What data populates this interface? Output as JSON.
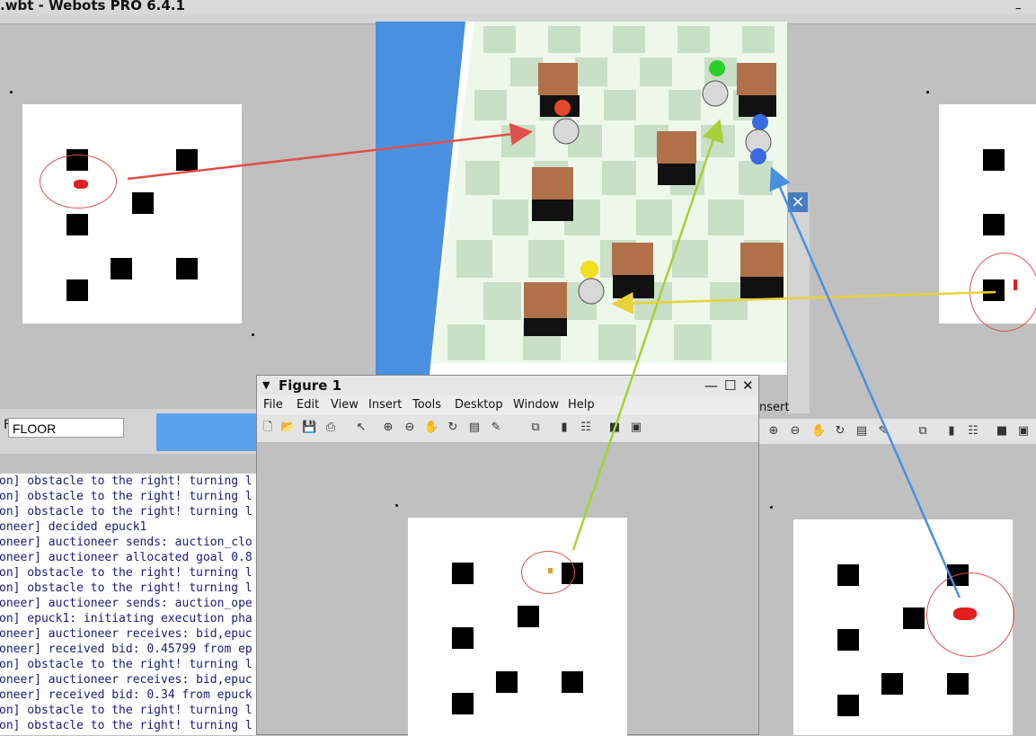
{
  "window": {
    "title": ".wbt - Webots PRO 6.4.1"
  },
  "field": {
    "value": "FLOOR",
    "label": "F"
  },
  "console_lines": [
    "on] obstacle to the right! turning l",
    "on] obstacle to the right! turning l",
    "on] obstacle to the right! turning l",
    "oneer] decided epuck1",
    "oneer] auctioneer sends: auction_clo",
    "oneer] auctioneer allocated goal 0.8",
    "on] obstacle to the right! turning l",
    "on] obstacle to the right! turning l",
    "oneer] auctioneer sends: auction_ope",
    "on] epuck1: initiating execution pha",
    "oneer] auctioneer receives: bid,epuc",
    "oneer] received bid: 0.45799 from ep",
    "on] obstacle to the right! turning l",
    "oneer] auctioneer receives: bid,epuc",
    "oneer] received bid: 0.34 from epuck",
    "on] obstacle to the right! turning l",
    "on] obstacle to the right! turning l"
  ],
  "figure": {
    "title": "Figure 1",
    "menu": [
      "File",
      "Edit",
      "View",
      "Insert",
      "Tools",
      "Desktop",
      "Window",
      "Help"
    ]
  },
  "side_label": "nsert",
  "colors": {
    "arrow_red": "#e0504a",
    "arrow_green": "#a8d03a",
    "arrow_yellow": "#e8d23a",
    "arrow_blue": "#4a90e0",
    "water": "#4a90e0"
  }
}
